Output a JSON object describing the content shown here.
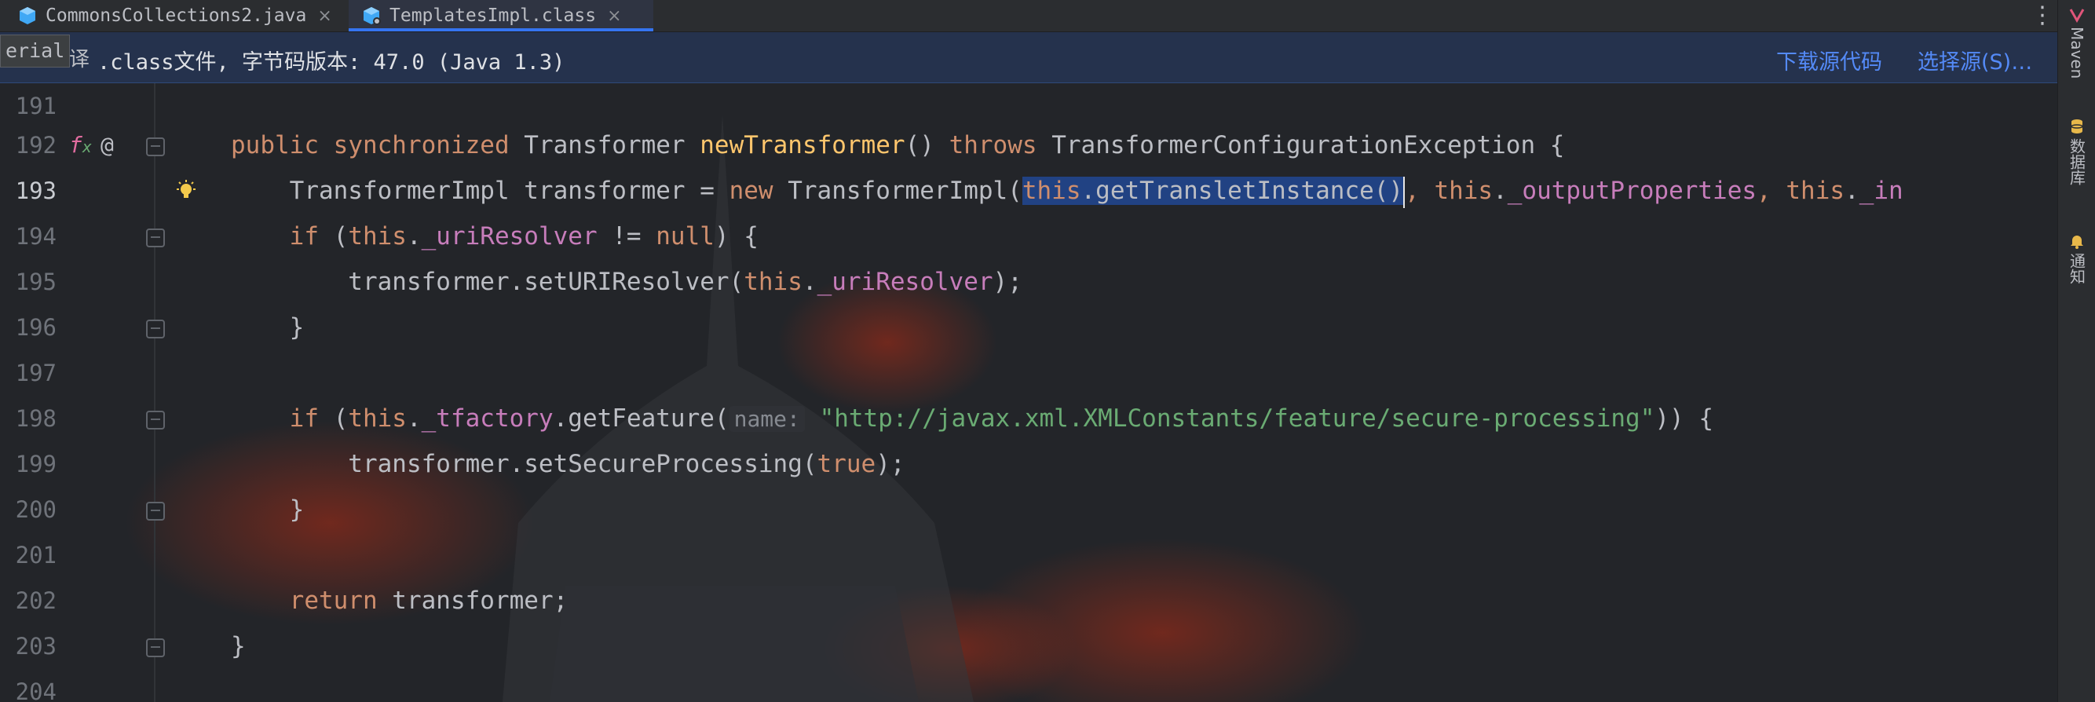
{
  "tabs": [
    {
      "label": "CommonsCollections2.java",
      "close": "×",
      "icon": "java-class-icon"
    },
    {
      "label": "TemplatesImpl.class",
      "close": "×",
      "icon": "class-file-icon"
    }
  ],
  "tab_more": "⋮",
  "tooltip_fragment": "erial",
  "banner": {
    "icon_fragment": "译",
    "message": ".class文件, 字节码版本: 47.0 (Java 1.3)",
    "download_source": "下载源代码",
    "choose_source": "选择源(S)…"
  },
  "right_tools": [
    {
      "label": "Maven",
      "icon": "maven-icon"
    },
    {
      "label": "数据库",
      "icon": "database-icon"
    },
    {
      "label": "通知",
      "icon": "notification-bell-icon"
    }
  ],
  "lines": [
    {
      "num": "191"
    },
    {
      "num": "192",
      "t": {
        "a": "public",
        "b": " ",
        "c": "synchronized",
        "d": " Transformer ",
        "e": "newTransformer",
        "f": "() ",
        "g": "throws",
        "h": " TransformerConfigurationException {"
      }
    },
    {
      "num": "193",
      "t": {
        "a": "    TransformerImpl transformer = ",
        "b": "new",
        "c": " TransformerImpl(",
        "d": "this",
        "e": ".getTransletInstance()",
        "f": ", ",
        "g": "this",
        "h": ".",
        "i": "_outputProperties",
        "j": ", ",
        "k": "this",
        "l": ".",
        "m": "_in"
      }
    },
    {
      "num": "194",
      "t": {
        "a": "    ",
        "b": "if",
        "c": " (",
        "d": "this",
        "e": ".",
        "f": "_uriResolver",
        "g": " != ",
        "h": "null",
        "i": ") {"
      }
    },
    {
      "num": "195",
      "t": {
        "a": "        transformer.setURIResolver(",
        "b": "this",
        "c": ".",
        "d": "_uriResolver",
        "e": ");"
      }
    },
    {
      "num": "196",
      "t": {
        "a": "    }"
      }
    },
    {
      "num": "197"
    },
    {
      "num": "198",
      "t": {
        "a": "    ",
        "b": "if",
        "c": " (",
        "d": "this",
        "e": ".",
        "f": "_tfactory",
        "g": ".getFeature(",
        "h": "name:",
        "i": " ",
        "j": "\"http://javax.xml.XMLConstants/feature/secure-processing\"",
        "k": ")) {"
      }
    },
    {
      "num": "199",
      "t": {
        "a": "        transformer.setSecureProcessing(",
        "b": "true",
        "c": ");"
      }
    },
    {
      "num": "200",
      "t": {
        "a": "    }"
      }
    },
    {
      "num": "201"
    },
    {
      "num": "202",
      "t": {
        "a": "    ",
        "b": "return",
        "c": " transformer;"
      }
    },
    {
      "num": "203",
      "t": {
        "a": "}"
      }
    },
    {
      "num": "204"
    }
  ],
  "gutter_icons": {
    "fx": "f",
    "at": "@"
  },
  "colors": {
    "keyword": "#cf8e6d",
    "method_decl": "#ffc66d",
    "field": "#c77dbb",
    "string": "#6aab73",
    "selection": "#214283",
    "accent": "#3574f0",
    "link": "#548af7"
  }
}
